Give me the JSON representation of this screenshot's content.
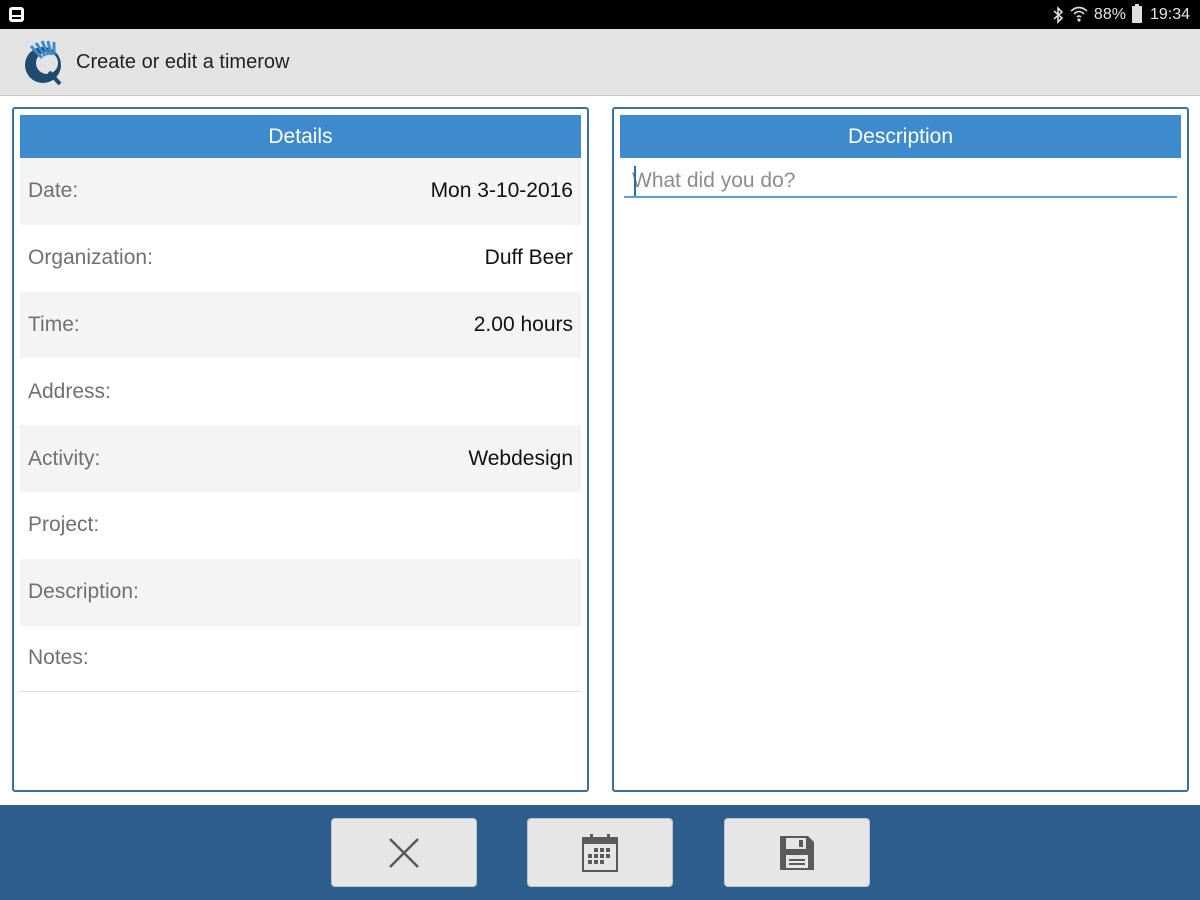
{
  "status_bar": {
    "battery": "88%",
    "time": "19:34",
    "icons": [
      "notification-icon",
      "bluetooth-icon",
      "wifi-icon",
      "battery-icon"
    ]
  },
  "app_bar": {
    "title": "Create or edit a timerow",
    "logo": "app-logo-icon"
  },
  "details_panel": {
    "header": "Details",
    "rows": [
      {
        "label": "Date:",
        "value": "Mon 3-10-2016"
      },
      {
        "label": "Organization:",
        "value": "Duff Beer"
      },
      {
        "label": "Time:",
        "value": "2.00 hours"
      },
      {
        "label": "Address:",
        "value": ""
      },
      {
        "label": "Activity:",
        "value": "Webdesign"
      },
      {
        "label": "Project:",
        "value": ""
      },
      {
        "label": "Description:",
        "value": ""
      },
      {
        "label": "Notes:",
        "value": ""
      }
    ]
  },
  "description_panel": {
    "header": "Description",
    "input": {
      "value": "",
      "placeholder": "What did you do?"
    }
  },
  "toolbar": {
    "buttons": [
      {
        "name": "cancel-button",
        "icon": "close-icon"
      },
      {
        "name": "calendar-button",
        "icon": "calendar-icon"
      },
      {
        "name": "save-button",
        "icon": "save-icon"
      }
    ]
  },
  "colors": {
    "accent": "#3d8bcd",
    "toolbar_bg": "#2e5f8c",
    "appbar_bg": "#e3e3e3"
  }
}
